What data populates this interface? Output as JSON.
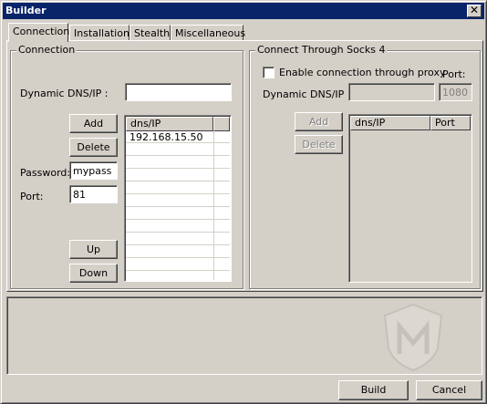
{
  "window": {
    "title": "Builder",
    "close_glyph": "✕"
  },
  "tabs": [
    "Connection",
    "Installation",
    "Stealth",
    "Miscellaneous"
  ],
  "connection": {
    "legend": "Connection",
    "dns_label": "Dynamic DNS/IP :",
    "dns_value": "",
    "add_label": "Add",
    "delete_label": "Delete",
    "password_label": "Password:",
    "password_value": "mypass",
    "port_label": "Port:",
    "port_value": "81",
    "up_label": "Up",
    "down_label": "Down",
    "list_columns": [
      "dns/IP",
      ""
    ],
    "list_rows": [
      "192.168.15.50"
    ]
  },
  "socks": {
    "legend": "Connect Through Socks 4",
    "enable_label": "Enable connection through proxy",
    "enable_checked": false,
    "port_label": "Port:",
    "dns_label": "Dynamic DNS/IP :",
    "dns_value": "",
    "port_value": "1080",
    "add_label": "Add",
    "delete_label": "Delete",
    "list_columns": [
      "dns/IP",
      "Port"
    ]
  },
  "footer": {
    "build_label": "Build",
    "cancel_label": "Cancel"
  },
  "colors": {
    "face": "#d4d0c8",
    "titlebar": "#0a246a",
    "disabled_text": "#808080"
  }
}
